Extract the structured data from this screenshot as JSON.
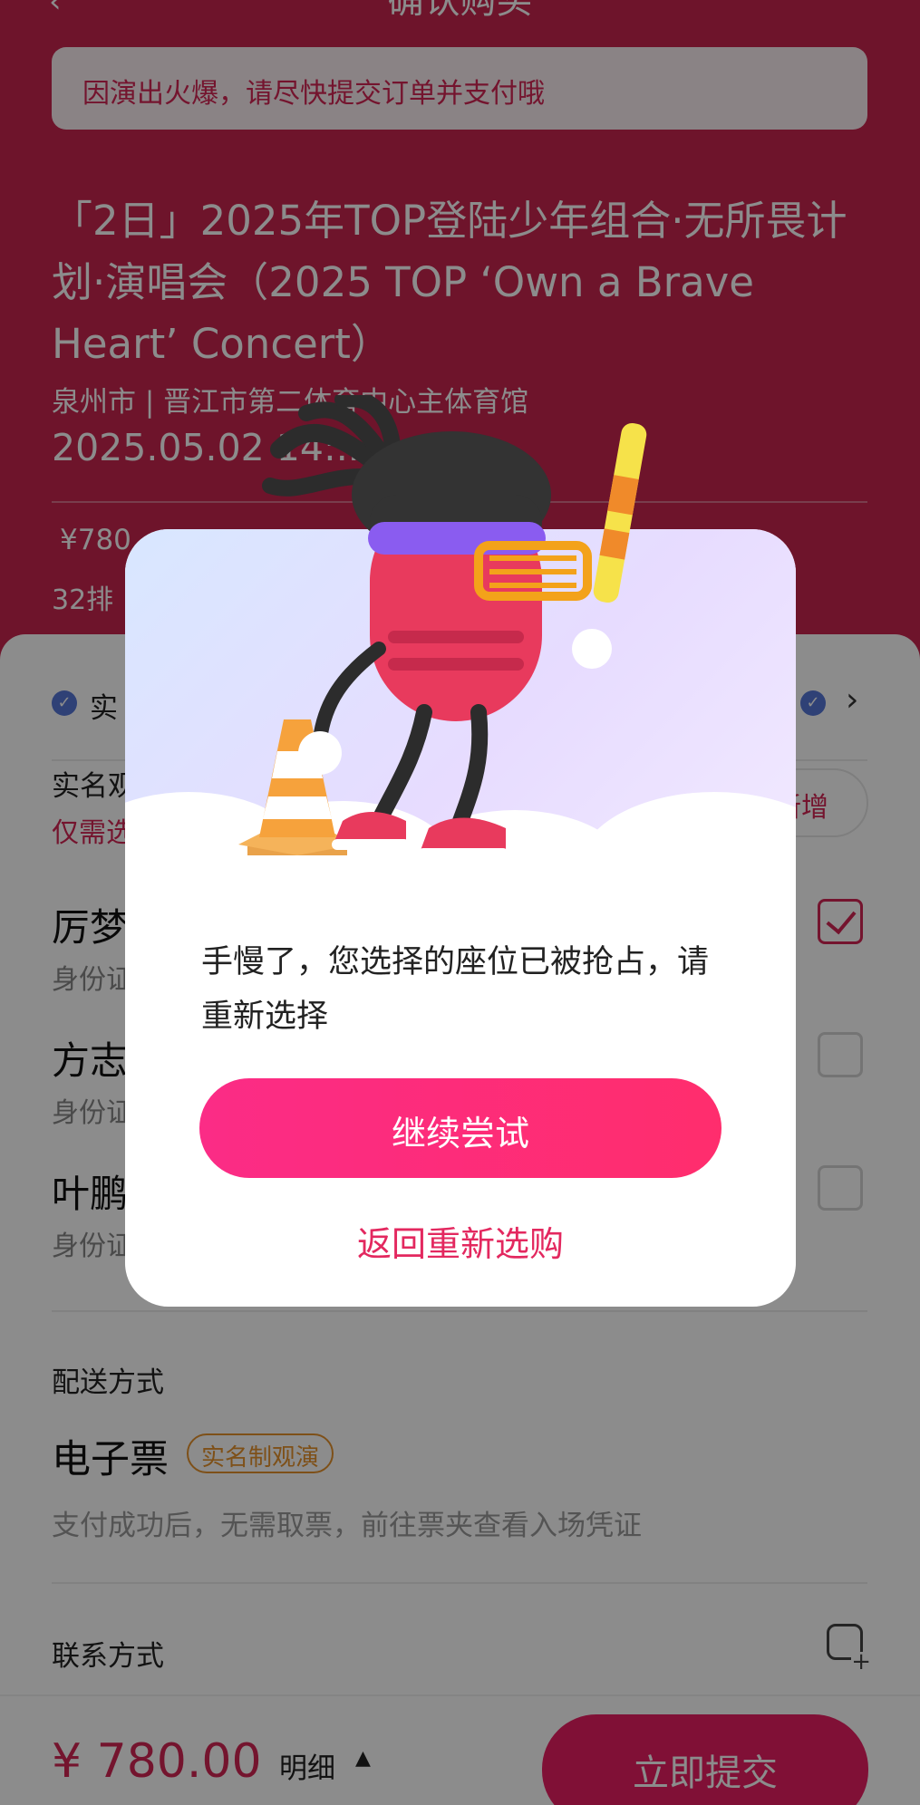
{
  "nav": {
    "title": "确认购买"
  },
  "notice": "因演出火爆，请尽快提交订单并支付哦",
  "event": {
    "title": "「2日」2025年TOP登陆少年组合·无所畏计划·演唱会（2025 TOP ‘Own a Brave Heart’ Concert）",
    "venue": "泉州市 | 晋江市第二体育中心主体育馆",
    "datetime": "2025.05.02 14:..",
    "price_tier": "¥780",
    "seat_row": "32排"
  },
  "sheet": {
    "row1_label": "实",
    "realname_title": "实名观",
    "realname_sub": "仅需选",
    "add_label": "新增",
    "persons": [
      {
        "name": "厉梦",
        "id_label": "身份证",
        "checked": true
      },
      {
        "name": "方志",
        "id_label": "身份证",
        "checked": false
      },
      {
        "name": "叶鹏",
        "id_label": "身份证",
        "checked": false
      }
    ],
    "delivery_label": "配送方式",
    "eticket_label": "电子票",
    "realname_badge": "实名制观演",
    "eticket_desc": "支付成功后，无需取票，前往票夹查看入场凭证",
    "contact_label": "联系方式"
  },
  "bottom": {
    "total": "¥ 780.00",
    "detail_label": "明细",
    "submit_label": "立即提交"
  },
  "dialog": {
    "message": "手慢了，您选择的座位已被抢占，请重新选择",
    "retry_label": "继续尝试",
    "back_label": "返回重新选购"
  },
  "colors": {
    "header_bg": "#c9254f",
    "accent": "#e91e63",
    "accent_text": "#d42654",
    "badge": "#e5922c"
  }
}
